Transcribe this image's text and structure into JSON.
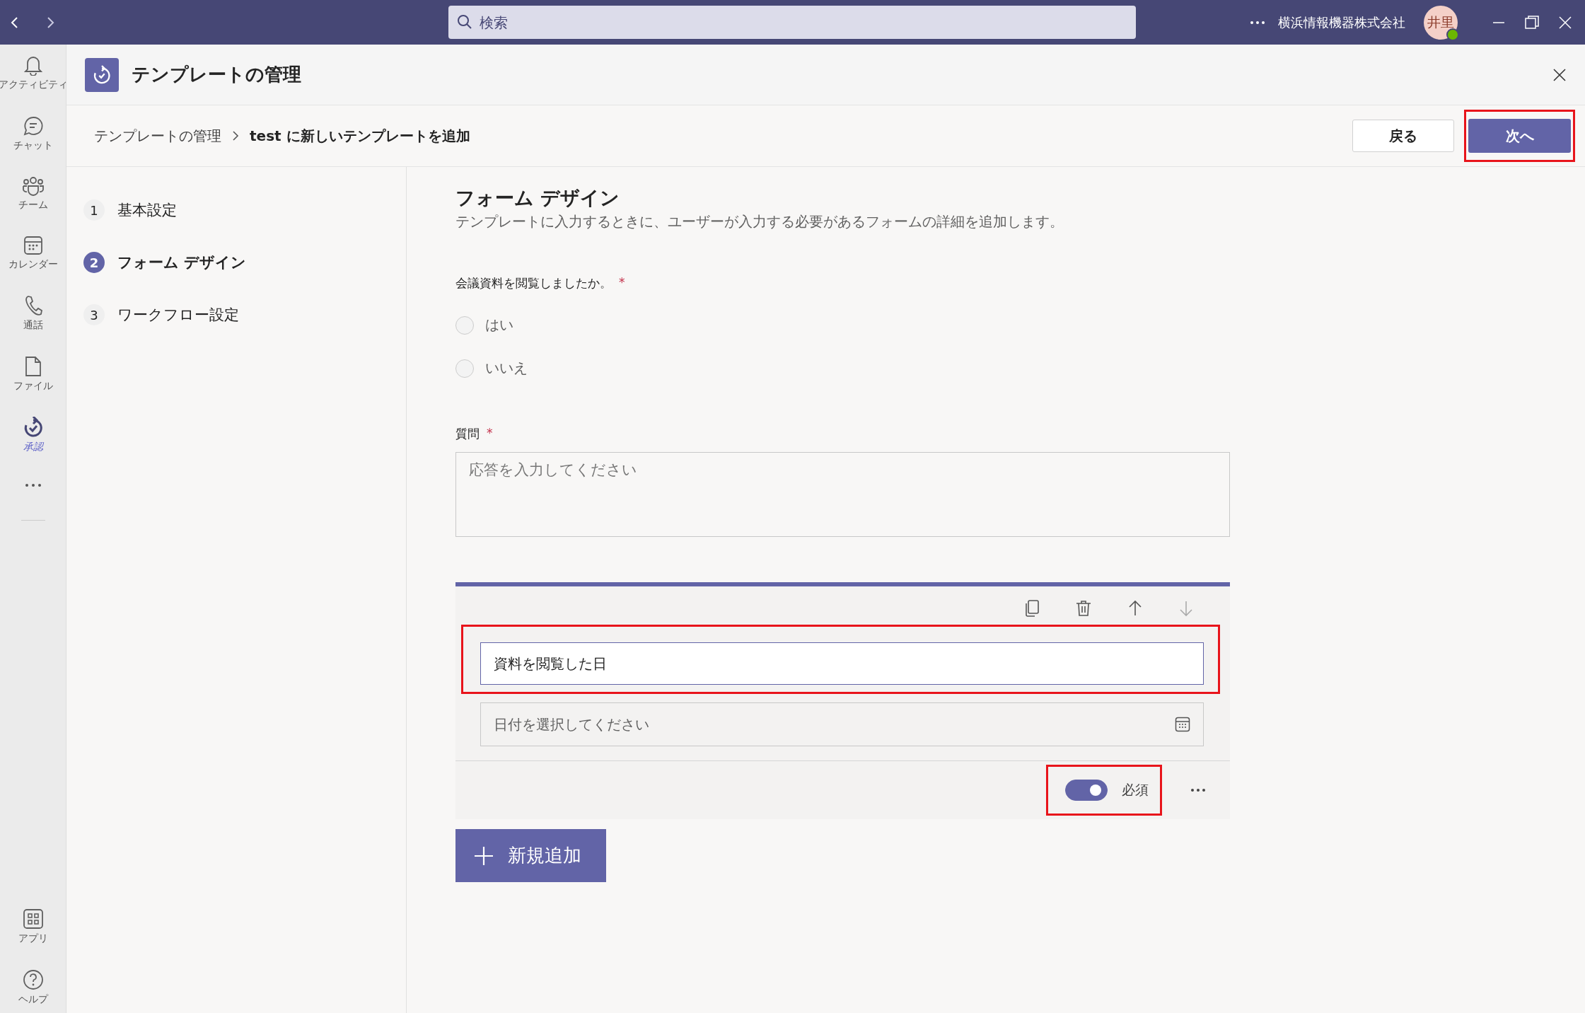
{
  "search": {
    "placeholder": "検索"
  },
  "org": "横浜情報機器株式会社",
  "avatar": {
    "initials": "井里"
  },
  "rail": [
    {
      "label": "アクティビティ",
      "selected": false
    },
    {
      "label": "チャット",
      "selected": false
    },
    {
      "label": "チーム",
      "selected": false
    },
    {
      "label": "カレンダー",
      "selected": false
    },
    {
      "label": "通話",
      "selected": false
    },
    {
      "label": "ファイル",
      "selected": false
    },
    {
      "label": "承認",
      "selected": true
    }
  ],
  "rail_bottom": [
    {
      "label": "アプリ"
    },
    {
      "label": "ヘルプ"
    }
  ],
  "page": {
    "title": "テンプレートの管理",
    "breadcrumb": [
      "テンプレートの管理",
      "test に新しいテンプレートを追加"
    ],
    "back_button": "戻る",
    "next_button": "次へ"
  },
  "steps": [
    {
      "number": "1",
      "label": "基本設定",
      "selected": false
    },
    {
      "number": "2",
      "label": "フォーム デザイン",
      "selected": true
    },
    {
      "number": "3",
      "label": "ワークフロー設定",
      "selected": false
    }
  ],
  "form": {
    "heading": "フォーム デザイン",
    "description": "テンプレートに入力するときに、ユーザーが入力する必要があるフォームの詳細を追加します。",
    "questions": [
      {
        "kind": "choice",
        "label": "会議資料を閲覧しましたか。",
        "required_mark": "*",
        "options": [
          {
            "label": "はい",
            "selected": false
          },
          {
            "label": "いいえ",
            "selected": false
          }
        ]
      },
      {
        "kind": "text",
        "label": "質問",
        "required_mark": "*",
        "placeholder": "応答を入力してください"
      },
      {
        "kind": "date",
        "title_value": "資料を閲覧した日",
        "placeholder": "日付を選択してください",
        "toggle": {
          "label": "必須",
          "on": true
        }
      }
    ],
    "add_button": "新規追加"
  }
}
